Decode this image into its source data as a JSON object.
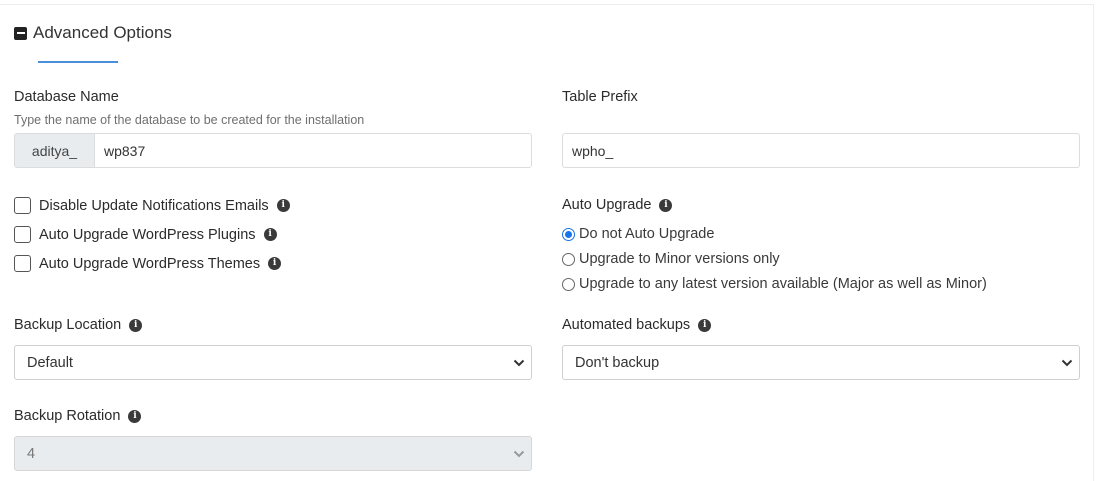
{
  "section": {
    "title": "Advanced Options"
  },
  "database": {
    "label": "Database Name",
    "hint": "Type the name of the database to be created for the installation",
    "prefix": "aditya_",
    "value": "wp837"
  },
  "table_prefix": {
    "label": "Table Prefix",
    "value": "wpho_"
  },
  "checkboxes": [
    {
      "label": "Disable Update Notifications Emails",
      "checked": false
    },
    {
      "label": "Auto Upgrade WordPress Plugins",
      "checked": false
    },
    {
      "label": "Auto Upgrade WordPress Themes",
      "checked": false
    }
  ],
  "auto_upgrade": {
    "label": "Auto Upgrade",
    "options": [
      {
        "label": "Do not Auto Upgrade",
        "checked": true
      },
      {
        "label": "Upgrade to Minor versions only",
        "checked": false
      },
      {
        "label": "Upgrade to any latest version available (Major as well as Minor)",
        "checked": false
      }
    ]
  },
  "backup_location": {
    "label": "Backup Location",
    "value": "Default"
  },
  "automated_backups": {
    "label": "Automated backups",
    "value": "Don't backup"
  },
  "backup_rotation": {
    "label": "Backup Rotation",
    "value": "4",
    "disabled": true
  },
  "colors": {
    "accent": "#4a8fd9",
    "radio": "#1a73e8",
    "addon_bg": "#e9ecef"
  },
  "icons": {
    "info": "info-icon",
    "collapse": "minus-square-icon",
    "dropdown": "chevron-down-icon"
  }
}
